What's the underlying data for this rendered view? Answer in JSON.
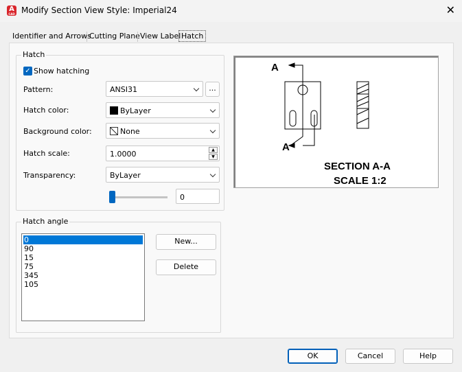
{
  "window": {
    "title": "Modify Section View Style: Imperial24",
    "app_icon_letter": "A",
    "app_icon_sub": "CAD",
    "close_glyph": "✕"
  },
  "tabs": [
    {
      "label": "Identifier and Arrows"
    },
    {
      "label": "Cutting Plane"
    },
    {
      "label": "View Label"
    },
    {
      "label": "Hatch",
      "active": true
    }
  ],
  "hatch_group": {
    "legend": "Hatch",
    "show_hatching": {
      "label": "Show hatching",
      "checked": true,
      "check_glyph": "✓"
    },
    "pattern": {
      "label": "Pattern:",
      "value": "ANSI31",
      "browse_label": "..."
    },
    "hatch_color": {
      "label": "Hatch color:",
      "value": "ByLayer"
    },
    "background_color": {
      "label": "Background color:",
      "value": "None"
    },
    "hatch_scale": {
      "label": "Hatch scale:",
      "value": "1.0000",
      "up_glyph": "▲",
      "down_glyph": "▼"
    },
    "transparency": {
      "label": "Transparency:",
      "value": "ByLayer",
      "slider_value": "0"
    }
  },
  "angle_group": {
    "legend": "Hatch angle",
    "items": [
      "0",
      "90",
      "15",
      "75",
      "345",
      "105"
    ],
    "selected_index": 0,
    "new_label": "New...",
    "delete_label": "Delete"
  },
  "preview": {
    "label_top": "A",
    "label_bottom": "A",
    "caption_line1": "SECTION A-A",
    "caption_line2": "SCALE 1:2"
  },
  "footer": {
    "ok_label": "OK",
    "cancel_label": "Cancel",
    "help_label": "Help"
  },
  "colors": {
    "accent": "#0067c0",
    "selection": "#0078d7"
  }
}
